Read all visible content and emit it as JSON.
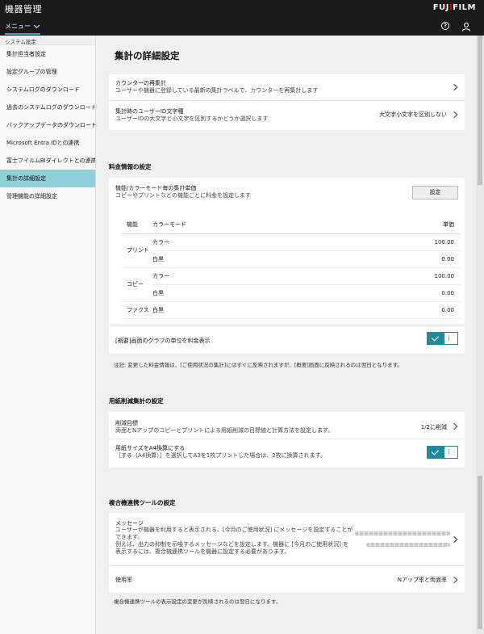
{
  "header": {
    "app_title": "機器管理",
    "brand_pre": "FUJ",
    "brand_i": "I",
    "brand_post": "FILM",
    "menu_label": "メニュー",
    "help_glyph": "?"
  },
  "sidebar": {
    "section": "システム設定",
    "items": [
      {
        "label": "集計担当者設定"
      },
      {
        "label": "設定グループの管理"
      },
      {
        "label": "システムログのダウンロード"
      },
      {
        "label": "過去のシステムログのダウンロード"
      },
      {
        "label": "バックアップデータのダウンロード"
      },
      {
        "label": "Microsoft Entra IDとの連携"
      },
      {
        "label": "富士フイルムBIダイレクトとの連携"
      },
      {
        "label": "集計の詳細設定",
        "active": true
      },
      {
        "label": "管理機能の詳細設定"
      }
    ]
  },
  "main": {
    "title": "集計の詳細設定",
    "general": {
      "recount_label": "カウンターの再集計",
      "recount_desc": "ユーザーや機器に登録している最新の集計ラベルで、カウンターを再集計します",
      "userid_label": "集計時のユーザーID文字種",
      "userid_desc": "ユーザーIDの大文字と小文字を区別するかどうか選択します",
      "userid_value": "大文字小文字を区別しない"
    },
    "pricing": {
      "section_title": "料金情報の設定",
      "unit_label": "機能/カラーモード毎の集計単価",
      "unit_desc": "コピーやプリントなどの機能ごとに料金を設定します",
      "set_button": "設定",
      "table_headers": {
        "function": "機能",
        "color_mode": "カラーモード",
        "price": "単価"
      },
      "rows": [
        {
          "function": "プリント",
          "modes": [
            {
              "mode": "カラー",
              "price": "100.00"
            },
            {
              "mode": "白黒",
              "price": "0.00"
            }
          ]
        },
        {
          "function": "コピー",
          "modes": [
            {
              "mode": "カラー",
              "price": "100.00"
            },
            {
              "mode": "白黒",
              "price": "0.00"
            }
          ]
        },
        {
          "function": "ファクス",
          "modes": [
            {
              "mode": "白黒",
              "price": "0.00"
            }
          ]
        }
      ],
      "graph_toggle_label": "[概要]画面のグラフの単位を料金表示",
      "graph_toggle_on": true,
      "note": "注記: 変更した料金情報は、[ご使用状況の集計]にはすぐに反映されますが、[概要]画面に反映されるのは翌日となります。"
    },
    "paper": {
      "section_title": "用紙削減集計の設定",
      "target_label": "削減目標",
      "target_desc": "両面とNアップのコピーとプリントによる用紙削減の目標値と計算方法を設定します。",
      "target_value": "1/2に削減",
      "a4_label": "用紙サイズをA4換算にする",
      "a4_desc": "［する（A4換算）］を選択してA3を1枚プリントした場合は、2枚に換算されます。",
      "a4_toggle_on": true
    },
    "tool": {
      "section_title": "複合機連携ツールの設定",
      "message_label": "メッセージ",
      "message_desc_1": "ユーザーが機器を利用すると表示される、[今月のご使用状況] にメッセージを設定することが",
      "message_desc_2": "できます。",
      "message_desc_3": "例えば、出力の抑制を示唆するメッセージなどを設定します。機器に [今月のご使用状況] を",
      "message_desc_4": "表示するには、複合機連携ツールを機器に設定する必要があります。",
      "usage_label": "使用率",
      "usage_value": "Nアップ率と両面率",
      "note": "複合機連携ツールの表示設定の変更が反映されるのは翌日になります。"
    }
  }
}
